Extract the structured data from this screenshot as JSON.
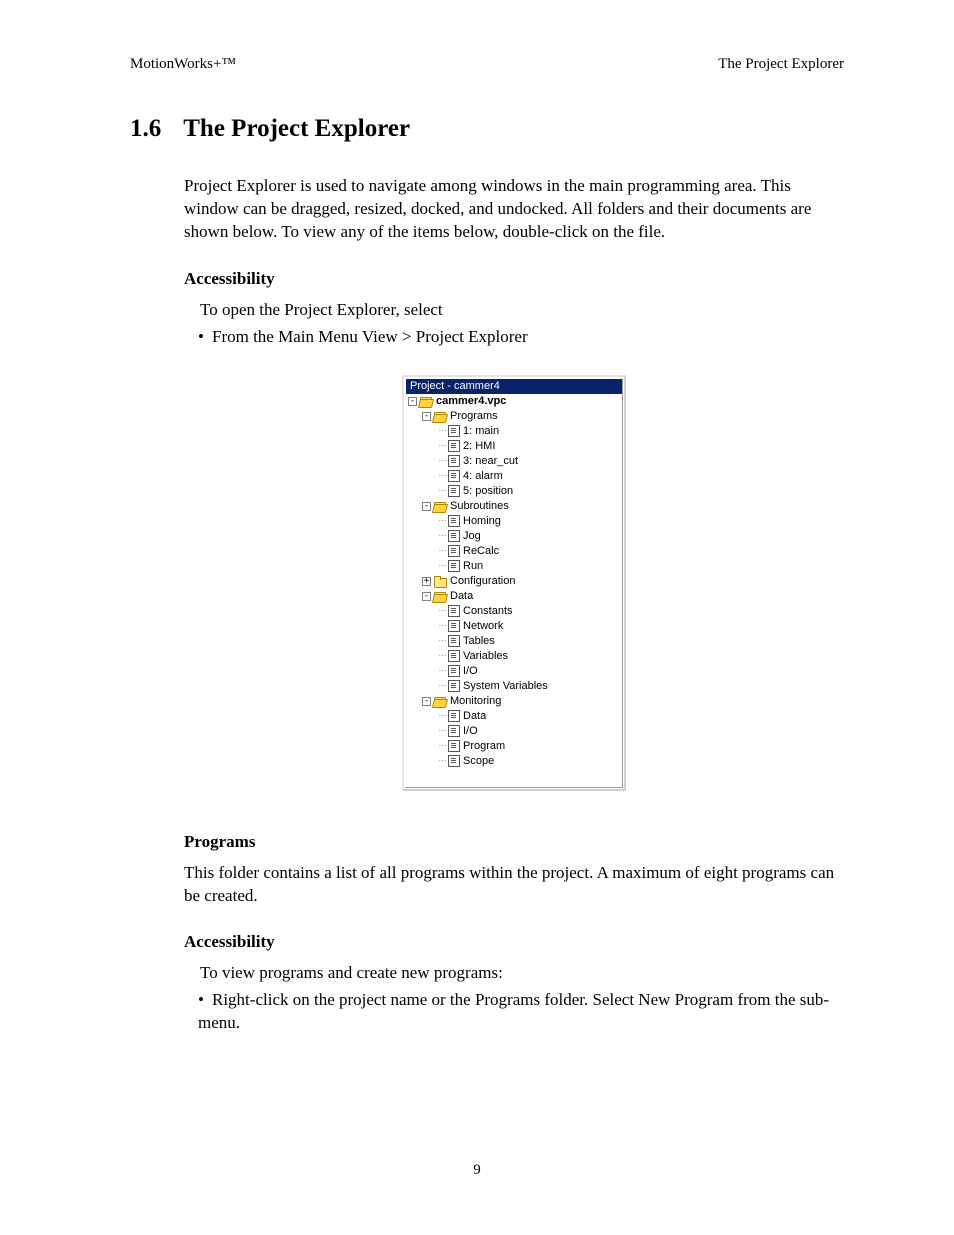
{
  "header": {
    "left": "MotionWorks+™",
    "right": "The Project Explorer"
  },
  "section": {
    "number": "1.6",
    "title": "The Project Explorer",
    "intro": "Project Explorer is used to navigate among windows in the main programming area.  This window can be dragged, resized, docked, and undocked.  All folders and their documents are shown below.  To view any of the items below, double-click on the file."
  },
  "accessibility1": {
    "heading": "Accessibility",
    "line1": "To open the Project Explorer, select",
    "bullet": "From the Main Menu View > Project Explorer"
  },
  "tree": {
    "title": "Project - cammer4",
    "root": {
      "label": "cammer4.vpc",
      "expander": "-"
    },
    "programs": {
      "label": "Programs",
      "expander": "-",
      "items": [
        "1: main",
        "2: HMI",
        "3: near_cut",
        "4: alarm",
        "5: position"
      ]
    },
    "subroutines": {
      "label": "Subroutines",
      "expander": "-",
      "items": [
        "Homing",
        "Jog",
        "ReCalc",
        "Run"
      ]
    },
    "configuration": {
      "label": "Configuration",
      "expander": "+"
    },
    "data": {
      "label": "Data",
      "expander": "-",
      "items": [
        "Constants",
        "Network",
        "Tables",
        "Variables",
        "I/O",
        "System Variables"
      ]
    },
    "monitoring": {
      "label": "Monitoring",
      "expander": "-",
      "items": [
        "Data",
        "I/O",
        "Program",
        "Scope"
      ]
    }
  },
  "programs_section": {
    "heading": "Programs",
    "body": "This folder contains a list of all programs within the project.  A maximum of eight programs can be created."
  },
  "accessibility2": {
    "heading": "Accessibility",
    "line1": "To view programs and create new programs:",
    "bullet": "Right-click on the project name or the Programs folder.  Select New Program from the sub-menu."
  },
  "page_number": "9"
}
